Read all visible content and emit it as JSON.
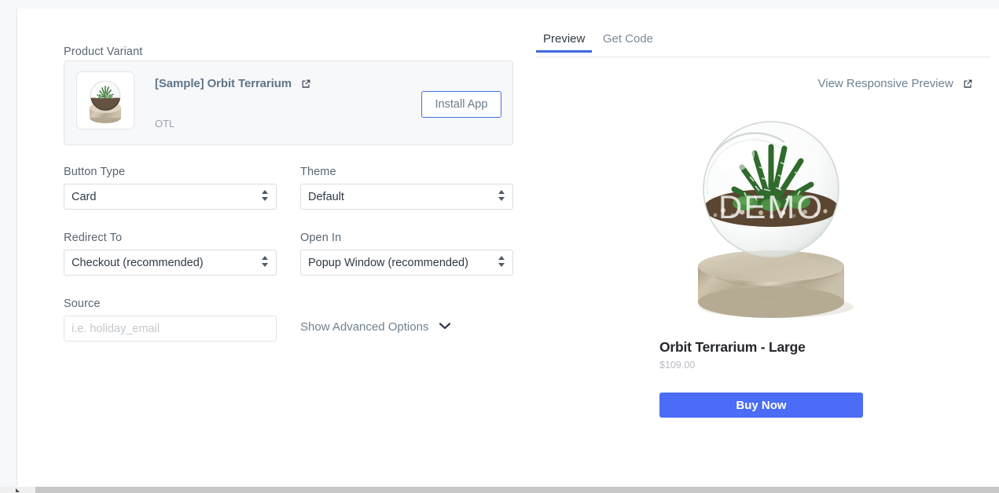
{
  "form": {
    "product_variant_label": "Product Variant",
    "variant": {
      "title": "[Sample] Orbit Terrarium",
      "sku": "OTL",
      "install_label": "Install App",
      "external_link_icon": "external-link-icon",
      "thumbnail_alt": "Orbit Terrarium product thumbnail"
    },
    "fields": [
      {
        "label": "Button Type",
        "value": "Card",
        "name": "button-type"
      },
      {
        "label": "Theme",
        "value": "Default",
        "name": "theme"
      },
      {
        "label": "Redirect To",
        "value": "Checkout (recommended)",
        "name": "redirect-to"
      },
      {
        "label": "Open In",
        "value": "Popup Window (recommended)",
        "name": "open-in"
      }
    ],
    "source": {
      "label": "Source",
      "value": "",
      "placeholder": "i.e. holiday_email"
    },
    "advanced_options_label": "Show Advanced Options",
    "chevron_icon": "chevron-down-icon"
  },
  "right": {
    "tabs": [
      {
        "label": "Preview",
        "active": true
      },
      {
        "label": "Get Code",
        "active": false
      }
    ],
    "responsive_link": "View Responsive Preview",
    "responsive_link_icon": "external-link-icon",
    "product": {
      "name": "Orbit Terrarium - Large",
      "price": "$109.00",
      "buy_label": "Buy Now",
      "image_watermark": "DEMO"
    }
  },
  "colors": {
    "accent_blue": "#4a6cf7",
    "tab_underline": "#3f68e0",
    "install_border": "#3f6fe4",
    "card_bg": "#f7f8fa",
    "muted_text": "#6f8291"
  }
}
